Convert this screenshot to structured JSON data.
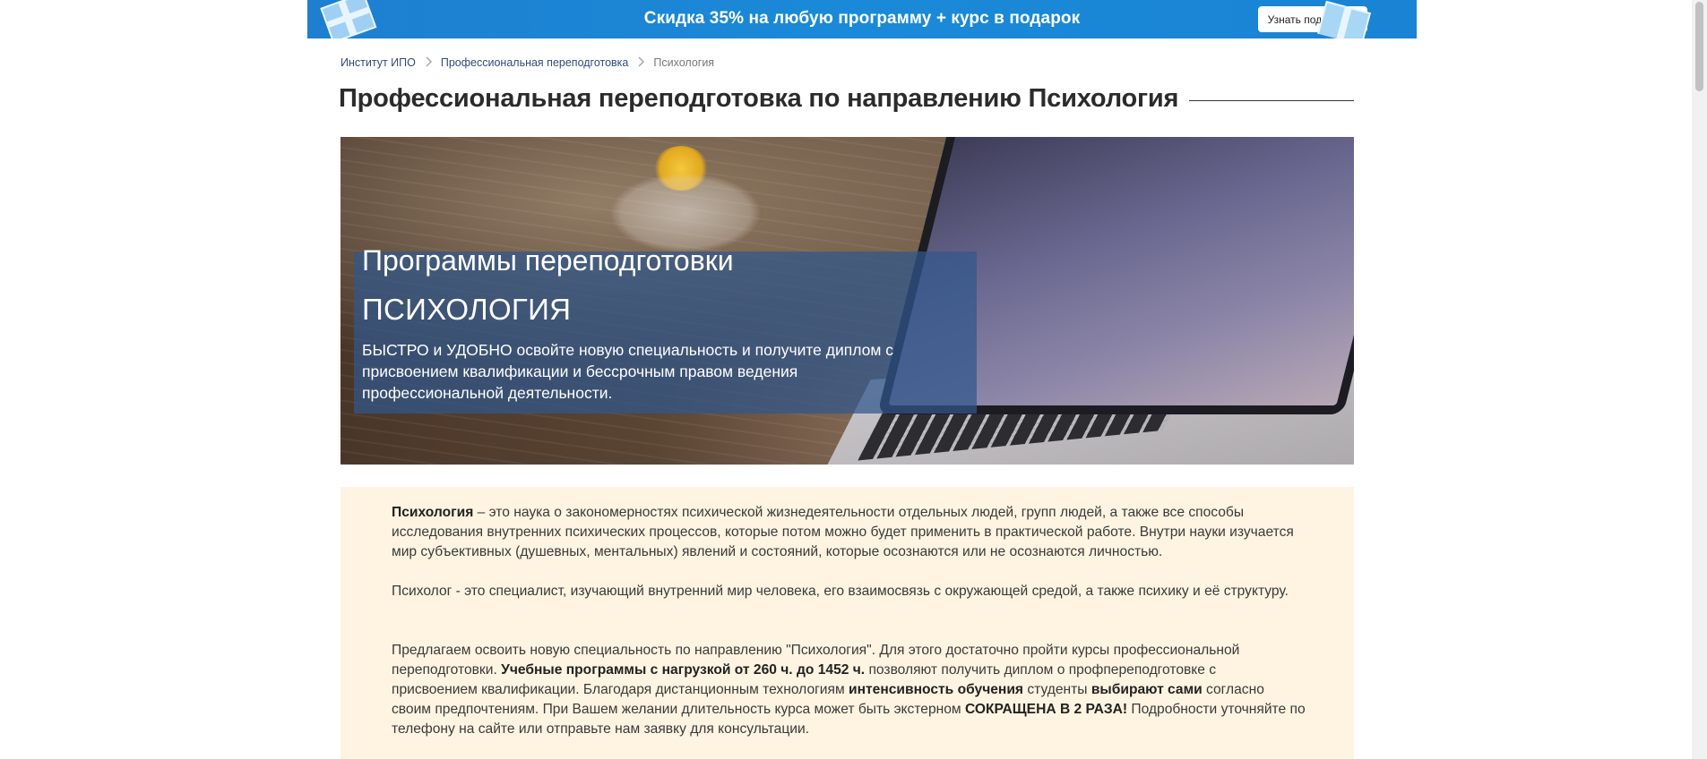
{
  "promo": {
    "text": "Скидка 35% на любую программу + курс в подарок",
    "button_label": "Узнать подробнее",
    "background_color": "#1a83d3"
  },
  "breadcrumb": {
    "items": [
      "Институт ИПО",
      "Профессиональная переподготовка",
      "Психология"
    ],
    "separator": "›"
  },
  "page": {
    "title": "Профессиональная переподготовка по направлению Психология"
  },
  "hero": {
    "title": "Программы переподготовки",
    "subtitle": "ПСИХОЛОГИЯ",
    "description": "БЫСТРО и УДОБНО освойте новую специальность и получите диплом с присвоением квалификации и бессрочным правом ведения профессиональной деятельности."
  },
  "content": {
    "p1": {
      "term": "Психология",
      "text": " – это наука о закономерностях психической жизнедеятельности отдельных людей, групп людей, а также все способы исследования внутренних психических процессов, которые потом можно будет применить в практической работе. Внутри науки изучается мир субъективных (душевных, ментальных) явлений и состояний, которые осознаются или не осознаются личностью."
    },
    "p2": "Психолог - это специалист, изучающий внутренний мир человека, его взаимосвязь с окружающей средой, а также психику и её структуру.",
    "p3": {
      "a": "Предлагаем освоить новую специальность по направлению \"Психология\". Для этого достаточно пройти курсы профессиональной переподготовки. ",
      "b": "Учебные программы с нагрузкой от 260 ч. до 1452 ч.",
      "c": " позволяют получить диплом о профпереподготовке с присвоением квалификации. Благодаря дистанционным технологиям ",
      "d": "интенсивность обучения",
      "e": " студенты ",
      "f": "выбирают сами",
      "g": " согласно своим предпочтениям. При Вашем желании длительность курса может быть экстерном ",
      "h": "СОКРАЩЕНА В 2 РАЗА!",
      "i": " Подробности уточняйте по телефону на сайте или отправьте нам заявку для консультации."
    },
    "background_color": "#fff4e1"
  }
}
